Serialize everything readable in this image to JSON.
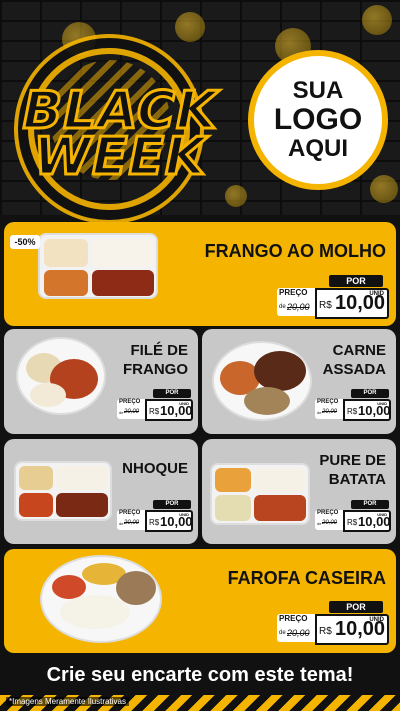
{
  "header": {
    "black": "BLACK",
    "week": "WEEK",
    "logo_line1": "SUA",
    "logo_line2": "LOGO",
    "logo_line3": "AQUI"
  },
  "discount_badge": "-50%",
  "products": [
    {
      "name_line1": "FRANGO AO MOLHO",
      "name_line2": "",
      "por": "POR",
      "preco": "PREÇO",
      "de": "de",
      "old": "20,00",
      "rs": "R$",
      "price": "10,00",
      "unid": "UNID"
    },
    {
      "name_line1": "FILÉ DE",
      "name_line2": "FRANGO",
      "por": "POR",
      "preco": "PREÇO",
      "de": "de",
      "old": "20,00",
      "rs": "R$",
      "price": "10,00",
      "unid": "UNID"
    },
    {
      "name_line1": "CARNE",
      "name_line2": "ASSADA",
      "por": "POR",
      "preco": "PREÇO",
      "de": "de",
      "old": "20,00",
      "rs": "R$",
      "price": "10,00",
      "unid": "UNID"
    },
    {
      "name_line1": "NHOQUE",
      "name_line2": "",
      "por": "POR",
      "preco": "PREÇO",
      "de": "de",
      "old": "20,00",
      "rs": "R$",
      "price": "10,00",
      "unid": "UNID"
    },
    {
      "name_line1": "PURE DE",
      "name_line2": "BATATA",
      "por": "POR",
      "preco": "PREÇO",
      "de": "de",
      "old": "20,00",
      "rs": "R$",
      "price": "10,00",
      "unid": "UNID"
    },
    {
      "name_line1": "FAROFA CASEIRA",
      "name_line2": "",
      "por": "POR",
      "preco": "PREÇO",
      "de": "de",
      "old": "20,00",
      "rs": "R$",
      "price": "10,00",
      "unid": "UNID"
    }
  ],
  "footer": {
    "cta": "Crie seu encarte com este tema!",
    "disclaimer": "*Imagens Meramente Ilustrativas"
  },
  "colors": {
    "accent": "#f5b400",
    "dark": "#111111",
    "card_gray": "#c8c8c8"
  }
}
